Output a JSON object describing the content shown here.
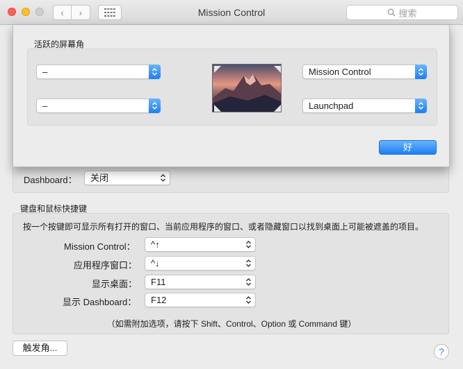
{
  "window": {
    "title": "Mission Control"
  },
  "toolbar": {
    "back_glyph": "‹",
    "forward_glyph": "›",
    "search_placeholder": "搜索"
  },
  "hot_corners_sheet": {
    "title": "活跃的屏幕角",
    "top_left": "–",
    "bottom_left": "–",
    "top_right": "Mission Control",
    "bottom_right": "Launchpad",
    "ok_label": "好"
  },
  "dashboard": {
    "label": "Dashboard：",
    "value": "关闭"
  },
  "shortcuts": {
    "title": "键盘和鼠标快捷键",
    "description": "按一个按键即可显示所有打开的窗口、当前应用程序的窗口、或者隐藏窗口以找到桌面上可能被遮盖的项目。",
    "rows": [
      {
        "label": "Mission Control：",
        "value": "^↑"
      },
      {
        "label": "应用程序窗口：",
        "value": "^↓"
      },
      {
        "label": "显示桌面：",
        "value": "F11"
      },
      {
        "label": "显示 Dashboard：",
        "value": "F12"
      }
    ],
    "footnote": "（如需附加选项，请按下 Shift、Control、Option 或 Command 键）"
  },
  "footer": {
    "hot_corners_button": "触发角...",
    "help_glyph": "?"
  },
  "colors": {
    "accent": "#1a7ff5"
  },
  "icons": [
    "search-icon",
    "grid-icon",
    "chevron-updown-icon",
    "help-icon"
  ]
}
